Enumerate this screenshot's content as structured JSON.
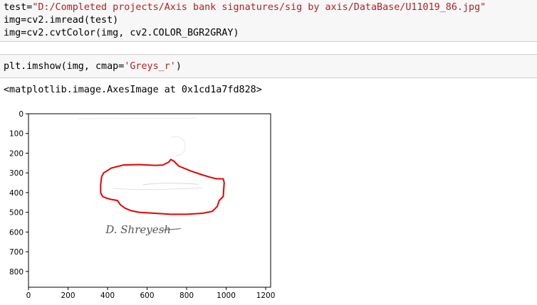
{
  "cells": [
    {
      "lines": [
        {
          "parts": [
            {
              "text": "test=",
              "cls": ""
            },
            {
              "text": "\"D:/Completed projects/Axis bank signatures/sig by axis/DataBase/U11019_86.jpg\"",
              "cls": "str"
            }
          ]
        },
        {
          "parts": [
            {
              "text": "img=cv2.imread(test)",
              "cls": ""
            }
          ]
        },
        {
          "parts": [
            {
              "text": "img=cv2.cvtColor(img, cv2.COLOR_BGR2GRAY)",
              "cls": ""
            }
          ]
        }
      ]
    },
    {
      "lines": [
        {
          "parts": [
            {
              "text": "plt.imshow(img, cmap=",
              "cls": ""
            },
            {
              "text": "'Greys_r'",
              "cls": "str"
            },
            {
              "text": ")",
              "cls": ""
            }
          ]
        }
      ]
    }
  ],
  "output": {
    "text": "<matplotlib.image.AxesImage at 0x1cd1a7fd828>"
  },
  "chart_data": {
    "type": "image",
    "xlim": [
      0,
      1225
    ],
    "ylim": [
      880,
      0
    ],
    "x_ticks": [
      0,
      200,
      400,
      600,
      800,
      1000,
      1200
    ],
    "y_ticks": [
      0,
      100,
      200,
      300,
      400,
      500,
      600,
      700,
      800
    ],
    "signature_text": "D. Shreyesh",
    "annotation_color": "#e60000",
    "annotation_outline": [
      [
        370,
        320
      ],
      [
        380,
        300
      ],
      [
        420,
        275
      ],
      [
        480,
        260
      ],
      [
        560,
        258
      ],
      [
        640,
        262
      ],
      [
        680,
        260
      ],
      [
        710,
        245
      ],
      [
        720,
        232
      ],
      [
        735,
        240
      ],
      [
        760,
        265
      ],
      [
        820,
        290
      ],
      [
        880,
        310
      ],
      [
        920,
        322
      ],
      [
        950,
        330
      ],
      [
        985,
        330
      ],
      [
        990,
        350
      ],
      [
        985,
        420
      ],
      [
        965,
        440
      ],
      [
        955,
        470
      ],
      [
        930,
        495
      ],
      [
        880,
        505
      ],
      [
        800,
        510
      ],
      [
        720,
        510
      ],
      [
        640,
        505
      ],
      [
        560,
        500
      ],
      [
        520,
        492
      ],
      [
        490,
        480
      ],
      [
        465,
        462
      ],
      [
        450,
        440
      ],
      [
        420,
        435
      ],
      [
        400,
        430
      ],
      [
        375,
        420
      ],
      [
        365,
        400
      ],
      [
        365,
        360
      ],
      [
        370,
        320
      ]
    ]
  }
}
